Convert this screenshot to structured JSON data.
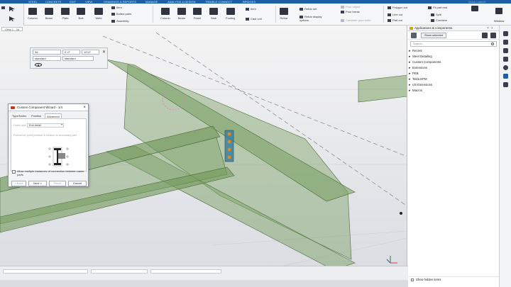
{
  "ribbon": {
    "tabs": [
      "STEEL",
      "CONCRETE",
      "EDIT",
      "VIEW",
      "DRAWINGS & REPORTS",
      "MANAGE",
      "ANALYSIS & DESIGN",
      "TRIMBLE CONNECT",
      "BRIDGES"
    ],
    "steel_group": {
      "column": "Column",
      "beam": "Beam",
      "plate": "Plate",
      "bolt": "Bolt",
      "weld": "Weld",
      "item": "Item",
      "bolted_parts": "Bolted parts",
      "assembly": "Assembly"
    },
    "concrete_group": {
      "column": "Column",
      "beam": "Beam",
      "panel": "Panel",
      "slab": "Slab",
      "footing": "Footing",
      "item": "Item",
      "cast_unit": "Cast unit"
    },
    "rebar_group": {
      "rebar": "Rebar",
      "rebar_set": "Rebar set",
      "rebar_display_options": "Rebar display options",
      "pour_object": "Pour object",
      "pour_break": "Pour break",
      "calculate_pour_units": "Calculate pour units"
    },
    "cut_group": {
      "polygon_cut": "Polygon cut",
      "fit_part_end": "Fit part end",
      "line_cut": "Line cut",
      "split": "Split",
      "part_cut": "Part cut",
      "combine": "Combine"
    },
    "quick_launch": "Quick Launch",
    "window": "Window"
  },
  "view": {
    "tab_label": "View 1 - 3d",
    "coord_box": {
      "field1": "3d",
      "field2": "0'-0\"",
      "field3": "10'-0\"",
      "select1": "standard",
      "select2": "standard"
    }
  },
  "wizard": {
    "title": "Custom Component Wizard - 1/4",
    "tabs": [
      "Type/Notes",
      "Position",
      "Advanced"
    ],
    "detail_type_label": "Detail type",
    "detail_type_value": "End detail",
    "position_label": "Reference point position in relation to secondary part",
    "allow_multiple": "Allow multiple instances of connection between same parts",
    "buttons": {
      "back": "< Back",
      "next": "Next >",
      "finish": "Finish",
      "cancel": "Cancel"
    }
  },
  "right_panel": {
    "title": "Applications & components",
    "show_selected": "Show selected",
    "search_placeholder": "Search...",
    "tree": [
      "Recent",
      "Steel Detailing",
      "Custom Components",
      "Extensions",
      "PEB",
      "Tekla EPM",
      "US Extensions",
      "Macros"
    ],
    "show_hidden_items": "Show hidden items"
  },
  "colors": {
    "ribbon_blue": "#1b5fa6",
    "steel_green": "#7ca265",
    "bolt_orange": "#e08a1e",
    "plate_blue": "#3e7f9e"
  }
}
